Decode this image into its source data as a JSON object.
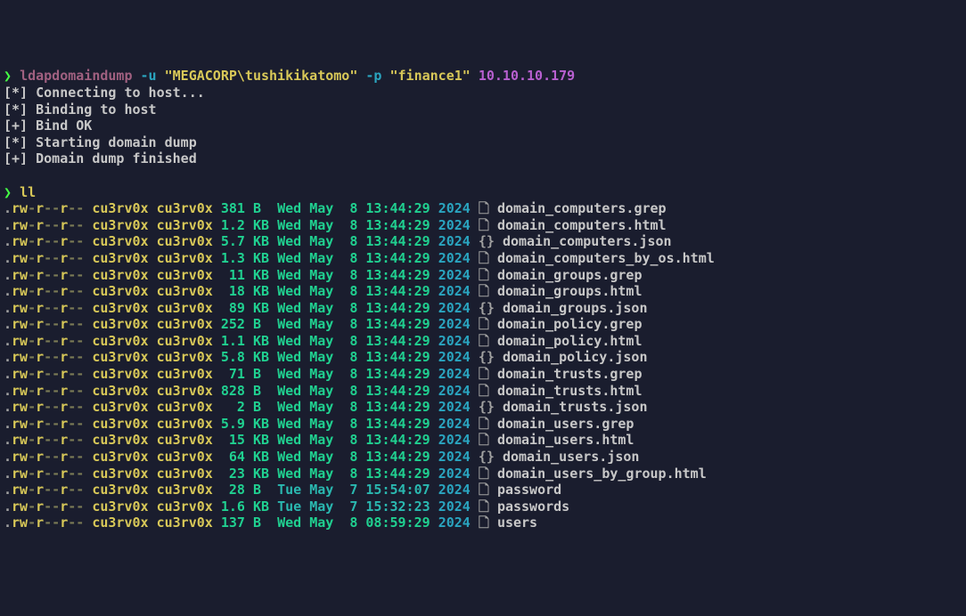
{
  "command": {
    "prompt": "❯",
    "name": "ldapdomaindump",
    "flag_u": "-u",
    "user": "\"MEGACORP\\tushikikatomo\"",
    "flag_p": "-p",
    "pass": "\"finance1\"",
    "target": "10.10.10.179"
  },
  "status_lines": [
    "[*] Connecting to host...",
    "[*] Binding to host",
    "[+] Bind OK",
    "[*] Starting domain dump",
    "[+] Domain dump finished"
  ],
  "ll_cmd": {
    "prompt": "❯",
    "cmd": "ll"
  },
  "owner": "cu3rv0x",
  "group": "cu3rv0x",
  "files": [
    {
      "size": "381",
      "unit": "B ",
      "wday": "Wed",
      "mon": "May",
      "day": " 8",
      "time": "13:44:29",
      "year": "2024",
      "icon": "🗋",
      "name": "domain_computers.grep",
      "alt": false
    },
    {
      "size": "1.2",
      "unit": "KB",
      "wday": "Wed",
      "mon": "May",
      "day": " 8",
      "time": "13:44:29",
      "year": "2024",
      "icon": "🗋",
      "name": "domain_computers.html",
      "alt": false
    },
    {
      "size": "5.7",
      "unit": "KB",
      "wday": "Wed",
      "mon": "May",
      "day": " 8",
      "time": "13:44:29",
      "year": "2024",
      "icon": "{}",
      "name": "domain_computers.json",
      "alt": false
    },
    {
      "size": "1.3",
      "unit": "KB",
      "wday": "Wed",
      "mon": "May",
      "day": " 8",
      "time": "13:44:29",
      "year": "2024",
      "icon": "🗋",
      "name": "domain_computers_by_os.html",
      "alt": false
    },
    {
      "size": " 11",
      "unit": "KB",
      "wday": "Wed",
      "mon": "May",
      "day": " 8",
      "time": "13:44:29",
      "year": "2024",
      "icon": "🗋",
      "name": "domain_groups.grep",
      "alt": false
    },
    {
      "size": " 18",
      "unit": "KB",
      "wday": "Wed",
      "mon": "May",
      "day": " 8",
      "time": "13:44:29",
      "year": "2024",
      "icon": "🗋",
      "name": "domain_groups.html",
      "alt": false
    },
    {
      "size": " 89",
      "unit": "KB",
      "wday": "Wed",
      "mon": "May",
      "day": " 8",
      "time": "13:44:29",
      "year": "2024",
      "icon": "{}",
      "name": "domain_groups.json",
      "alt": false
    },
    {
      "size": "252",
      "unit": "B ",
      "wday": "Wed",
      "mon": "May",
      "day": " 8",
      "time": "13:44:29",
      "year": "2024",
      "icon": "🗋",
      "name": "domain_policy.grep",
      "alt": false
    },
    {
      "size": "1.1",
      "unit": "KB",
      "wday": "Wed",
      "mon": "May",
      "day": " 8",
      "time": "13:44:29",
      "year": "2024",
      "icon": "🗋",
      "name": "domain_policy.html",
      "alt": false
    },
    {
      "size": "5.8",
      "unit": "KB",
      "wday": "Wed",
      "mon": "May",
      "day": " 8",
      "time": "13:44:29",
      "year": "2024",
      "icon": "{}",
      "name": "domain_policy.json",
      "alt": false
    },
    {
      "size": " 71",
      "unit": "B ",
      "wday": "Wed",
      "mon": "May",
      "day": " 8",
      "time": "13:44:29",
      "year": "2024",
      "icon": "🗋",
      "name": "domain_trusts.grep",
      "alt": false
    },
    {
      "size": "828",
      "unit": "B ",
      "wday": "Wed",
      "mon": "May",
      "day": " 8",
      "time": "13:44:29",
      "year": "2024",
      "icon": "🗋",
      "name": "domain_trusts.html",
      "alt": false
    },
    {
      "size": "  2",
      "unit": "B ",
      "wday": "Wed",
      "mon": "May",
      "day": " 8",
      "time": "13:44:29",
      "year": "2024",
      "icon": "{}",
      "name": "domain_trusts.json",
      "alt": false
    },
    {
      "size": "5.9",
      "unit": "KB",
      "wday": "Wed",
      "mon": "May",
      "day": " 8",
      "time": "13:44:29",
      "year": "2024",
      "icon": "🗋",
      "name": "domain_users.grep",
      "alt": false
    },
    {
      "size": " 15",
      "unit": "KB",
      "wday": "Wed",
      "mon": "May",
      "day": " 8",
      "time": "13:44:29",
      "year": "2024",
      "icon": "🗋",
      "name": "domain_users.html",
      "alt": false
    },
    {
      "size": " 64",
      "unit": "KB",
      "wday": "Wed",
      "mon": "May",
      "day": " 8",
      "time": "13:44:29",
      "year": "2024",
      "icon": "{}",
      "name": "domain_users.json",
      "alt": false
    },
    {
      "size": " 23",
      "unit": "KB",
      "wday": "Wed",
      "mon": "May",
      "day": " 8",
      "time": "13:44:29",
      "year": "2024",
      "icon": "🗋",
      "name": "domain_users_by_group.html",
      "alt": false
    },
    {
      "size": " 28",
      "unit": "B ",
      "wday": "Tue",
      "mon": "May",
      "day": " 7",
      "time": "15:54:07",
      "year": "2024",
      "icon": "🗋",
      "name": "password",
      "alt": true
    },
    {
      "size": "1.6",
      "unit": "KB",
      "wday": "Tue",
      "mon": "May",
      "day": " 7",
      "time": "15:32:23",
      "year": "2024",
      "icon": "🗋",
      "name": "passwords",
      "alt": true
    },
    {
      "size": "137",
      "unit": "B ",
      "wday": "Wed",
      "mon": "May",
      "day": " 8",
      "time": "08:59:29",
      "year": "2024",
      "icon": "🗋",
      "name": "users",
      "alt": false
    }
  ]
}
